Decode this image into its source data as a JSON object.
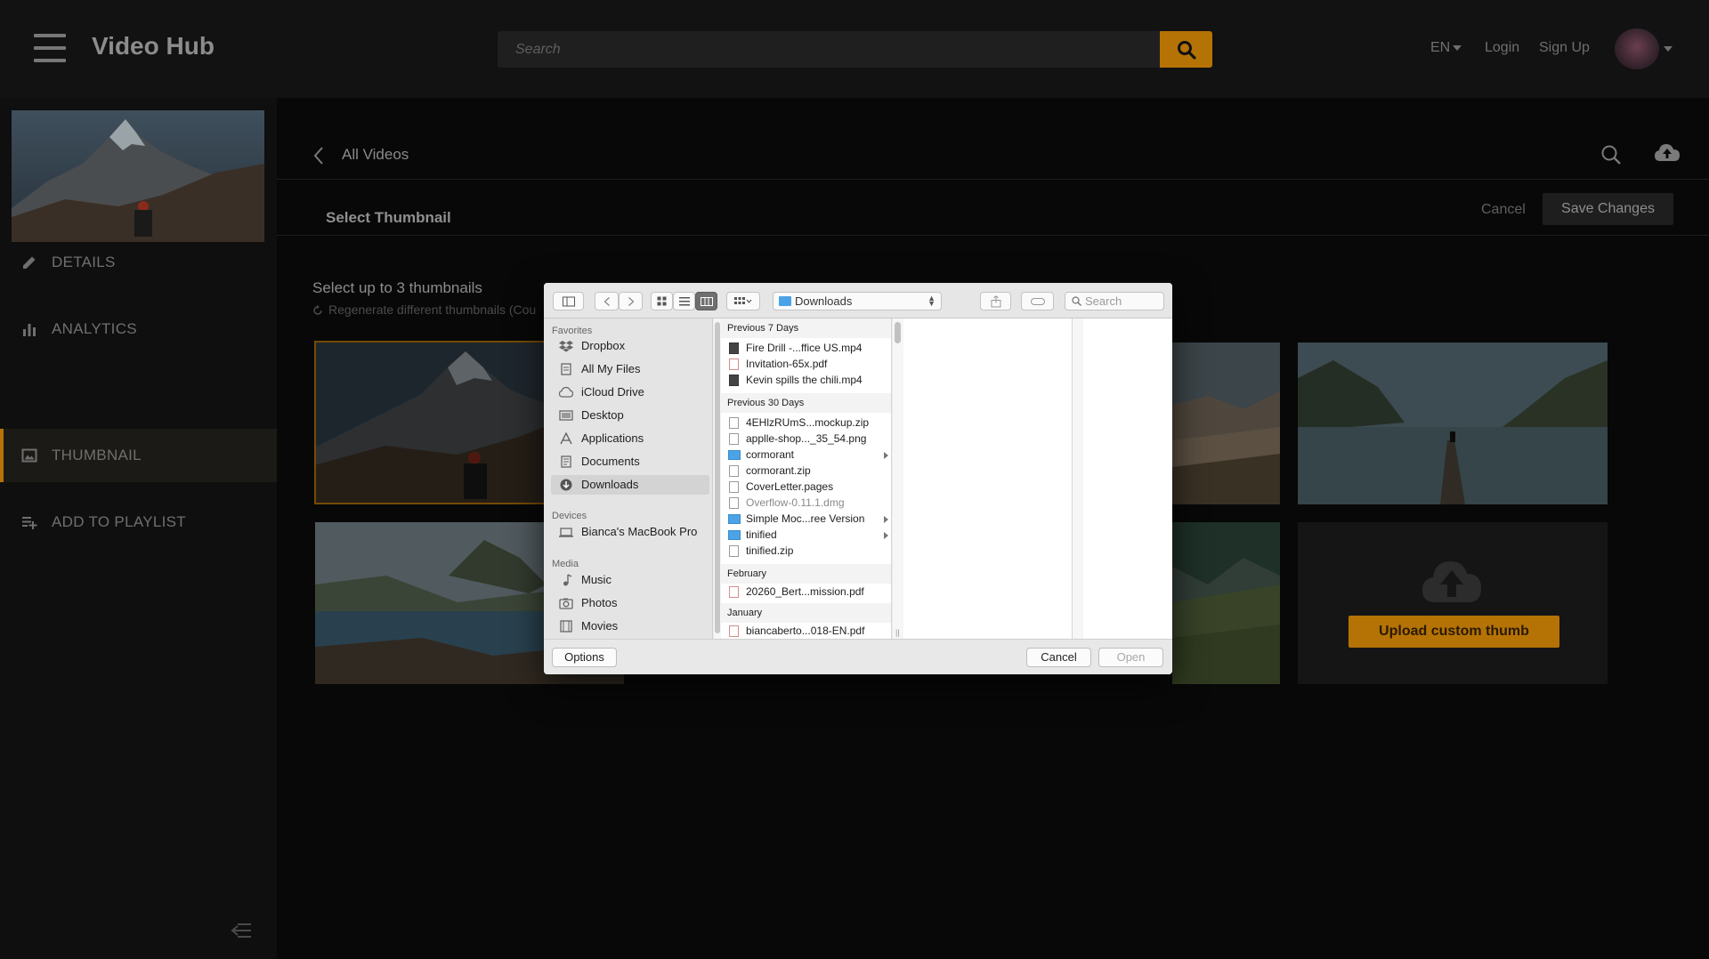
{
  "header": {
    "brand": "Video Hub",
    "search_placeholder": "Search",
    "language": "EN",
    "login": "Login",
    "signup": "Sign Up"
  },
  "sidebar": {
    "items": [
      {
        "label": "DETAILS",
        "icon": "pencil-icon"
      },
      {
        "label": "ANALYTICS",
        "icon": "bar-chart-icon"
      },
      {
        "label": "THUMBNAIL",
        "icon": "image-icon",
        "active": true
      },
      {
        "label": "ADD TO PLAYLIST",
        "icon": "playlist-add-icon"
      }
    ]
  },
  "main": {
    "breadcrumb": "All Videos",
    "section_title": "Select Thumbnail",
    "cancel": "Cancel",
    "save": "Save Changes",
    "subtitle": "Select up to 3 thumbnails",
    "regenerate": "Regenerate different thumbnails (Cou",
    "upload_label": "Upload custom thumb"
  },
  "dialog": {
    "location": "Downloads",
    "search_placeholder": "Search",
    "sidebar": {
      "favorites_head": "Favorites",
      "favorites": [
        "Dropbox",
        "All My Files",
        "iCloud Drive",
        "Desktop",
        "Applications",
        "Documents",
        "Downloads"
      ],
      "devices_head": "Devices",
      "devices": [
        "Bianca's MacBook Pro"
      ],
      "media_head": "Media",
      "media": [
        "Music",
        "Photos",
        "Movies"
      ]
    },
    "groups": [
      {
        "head": "Previous 7 Days",
        "files": [
          {
            "name": "Fire Drill  -...ffice US.mp4",
            "type": "vid"
          },
          {
            "name": "Invitation-65x.pdf",
            "type": "pdf"
          },
          {
            "name": "Kevin spills the chili.mp4",
            "type": "vid"
          }
        ]
      },
      {
        "head": "Previous 30 Days",
        "files": [
          {
            "name": "4EHlzRUmS...mockup.zip",
            "type": "zip"
          },
          {
            "name": "applle-shop..._35_54.png",
            "type": "img"
          },
          {
            "name": "cormorant",
            "type": "folder"
          },
          {
            "name": "cormorant.zip",
            "type": "zip"
          },
          {
            "name": "CoverLetter.pages",
            "type": "doc"
          },
          {
            "name": "Overflow-0.11.1.dmg",
            "type": "dmg"
          },
          {
            "name": "Simple Moc...ree Version",
            "type": "folder"
          },
          {
            "name": "tinified",
            "type": "folder"
          },
          {
            "name": "tinified.zip",
            "type": "zip"
          }
        ]
      },
      {
        "head": "February",
        "files": [
          {
            "name": "20260_Bert...mission.pdf",
            "type": "pdf"
          }
        ]
      },
      {
        "head": "January",
        "files": [
          {
            "name": "biancaberto...018-EN.pdf",
            "type": "pdf"
          }
        ]
      }
    ],
    "options": "Options",
    "cancel": "Cancel",
    "open": "Open"
  }
}
